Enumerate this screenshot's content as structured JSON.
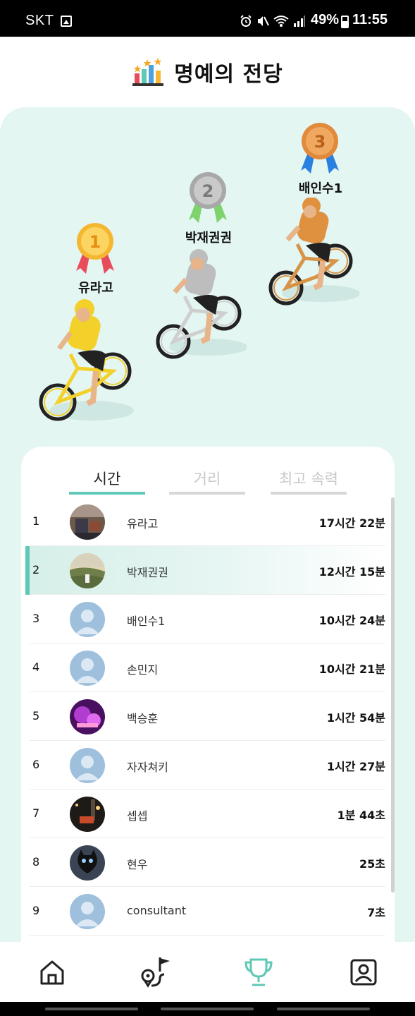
{
  "status_bar": {
    "carrier": "SKT",
    "battery": "49%",
    "time": "11:55"
  },
  "header": {
    "title": "명예의 전당",
    "icon": "podium-chart-icon"
  },
  "podium": {
    "first": {
      "rank_badge": "1",
      "name": "유라고",
      "medal_color": "#f5b731"
    },
    "second": {
      "rank_badge": "2",
      "name": "박재권권",
      "medal_color": "#a8a8a8"
    },
    "third": {
      "rank_badge": "3",
      "name": "배인수1",
      "medal_color": "#e28a3b"
    }
  },
  "tabs": [
    {
      "label": "시간",
      "active": true
    },
    {
      "label": "거리",
      "active": false
    },
    {
      "label": "최고 속력",
      "active": false
    }
  ],
  "ranking": [
    {
      "rank": "1",
      "name": "유라고",
      "value": "17시간 22분",
      "avatar": "photo-room"
    },
    {
      "rank": "2",
      "name": "박재권권",
      "value": "12시간 15분",
      "avatar": "photo-mountain",
      "highlight": true
    },
    {
      "rank": "3",
      "name": "배인수1",
      "value": "10시간 24분",
      "avatar": "default"
    },
    {
      "rank": "4",
      "name": "손민지",
      "value": "10시간 21분",
      "avatar": "default"
    },
    {
      "rank": "5",
      "name": "백승훈",
      "value": "1시간 54분",
      "avatar": "photo-purple"
    },
    {
      "rank": "6",
      "name": "자자쳐키",
      "value": "1시간 27분",
      "avatar": "default"
    },
    {
      "rank": "7",
      "name": "셉셉",
      "value": "1분 44초",
      "avatar": "photo-night"
    },
    {
      "rank": "8",
      "name": "현우",
      "value": "25초",
      "avatar": "photo-cat"
    },
    {
      "rank": "9",
      "name": "consultant",
      "value": "7초",
      "avatar": "default"
    }
  ],
  "bottom_nav": [
    {
      "icon": "home-icon",
      "active": false
    },
    {
      "icon": "route-flag-icon",
      "active": false
    },
    {
      "icon": "trophy-icon",
      "active": true
    },
    {
      "icon": "profile-icon",
      "active": false
    }
  ],
  "colors": {
    "accent": "#5fc8b7",
    "podium_bg": "#e3f6f2"
  }
}
